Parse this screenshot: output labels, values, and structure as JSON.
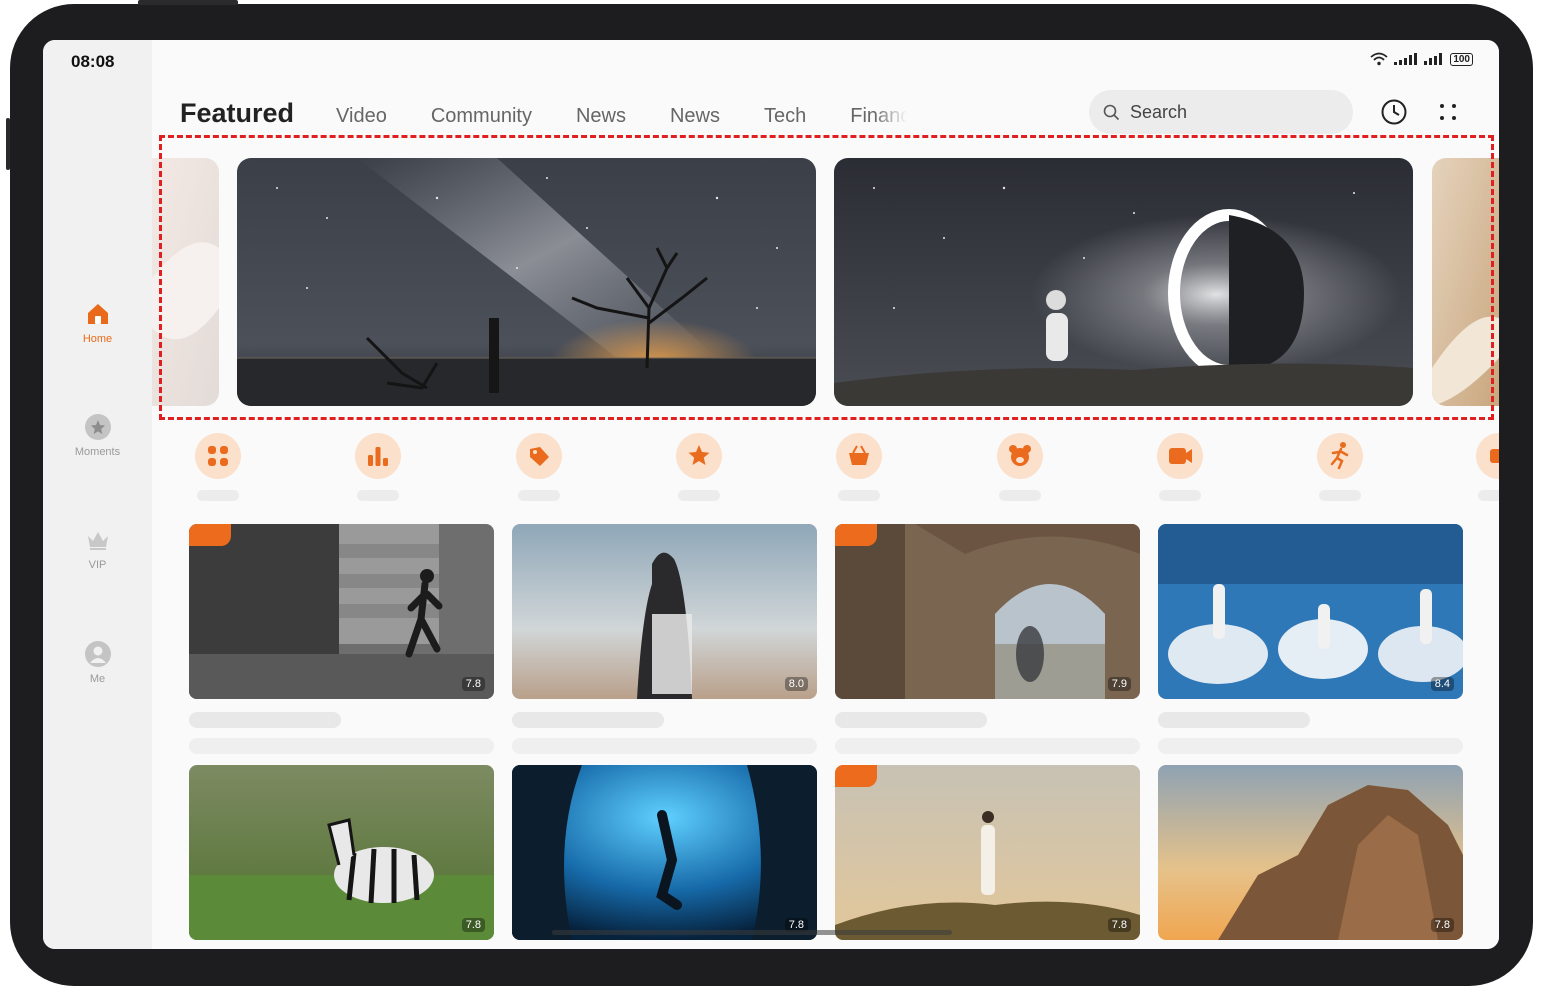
{
  "status_bar": {
    "time": "08:08",
    "battery": "100"
  },
  "sidebar": {
    "items": [
      {
        "label": "Home",
        "icon": "home-icon",
        "active": true
      },
      {
        "label": "Moments",
        "icon": "star-icon",
        "active": false
      },
      {
        "label": "VIP",
        "icon": "crown-icon",
        "active": false
      },
      {
        "label": "Me",
        "icon": "person-icon",
        "active": false
      }
    ]
  },
  "header": {
    "tabs": [
      "Featured",
      "Video",
      "Community",
      "News",
      "News",
      "Tech",
      "Financ"
    ],
    "active_tab": "Featured",
    "search_placeholder": "Search",
    "history_icon": "clock-icon",
    "more_icon": "grid-dots-icon"
  },
  "banners": [
    {
      "name": "milky-way-sea",
      "subject": "night sky over sea with dead trees"
    },
    {
      "name": "astronaut-portal",
      "subject": "astronaut facing glowing ring portal"
    }
  ],
  "categories": [
    {
      "icon": "apps-icon"
    },
    {
      "icon": "chart-icon"
    },
    {
      "icon": "coupon-icon"
    },
    {
      "icon": "star-icon"
    },
    {
      "icon": "vip-basket-icon"
    },
    {
      "icon": "bear-icon"
    },
    {
      "icon": "video-icon"
    },
    {
      "icon": "runner-icon"
    }
  ],
  "videos": [
    {
      "score": "7.8",
      "tag": true,
      "subject": "runner"
    },
    {
      "score": "8.0",
      "tag": false,
      "subject": "woman-silhouette"
    },
    {
      "score": "7.9",
      "tag": true,
      "subject": "archway"
    },
    {
      "score": "8.4",
      "tag": false,
      "subject": "ballet"
    },
    {
      "score": "7.8",
      "tag": false,
      "subject": "zebras"
    },
    {
      "score": "7.8",
      "tag": false,
      "subject": "diver"
    },
    {
      "score": "7.8",
      "tag": true,
      "subject": "woman-hill"
    },
    {
      "score": "7.8",
      "tag": false,
      "subject": "rocks"
    }
  ],
  "colors": {
    "accent": "#e96a1b",
    "highlight": "#e02020"
  }
}
